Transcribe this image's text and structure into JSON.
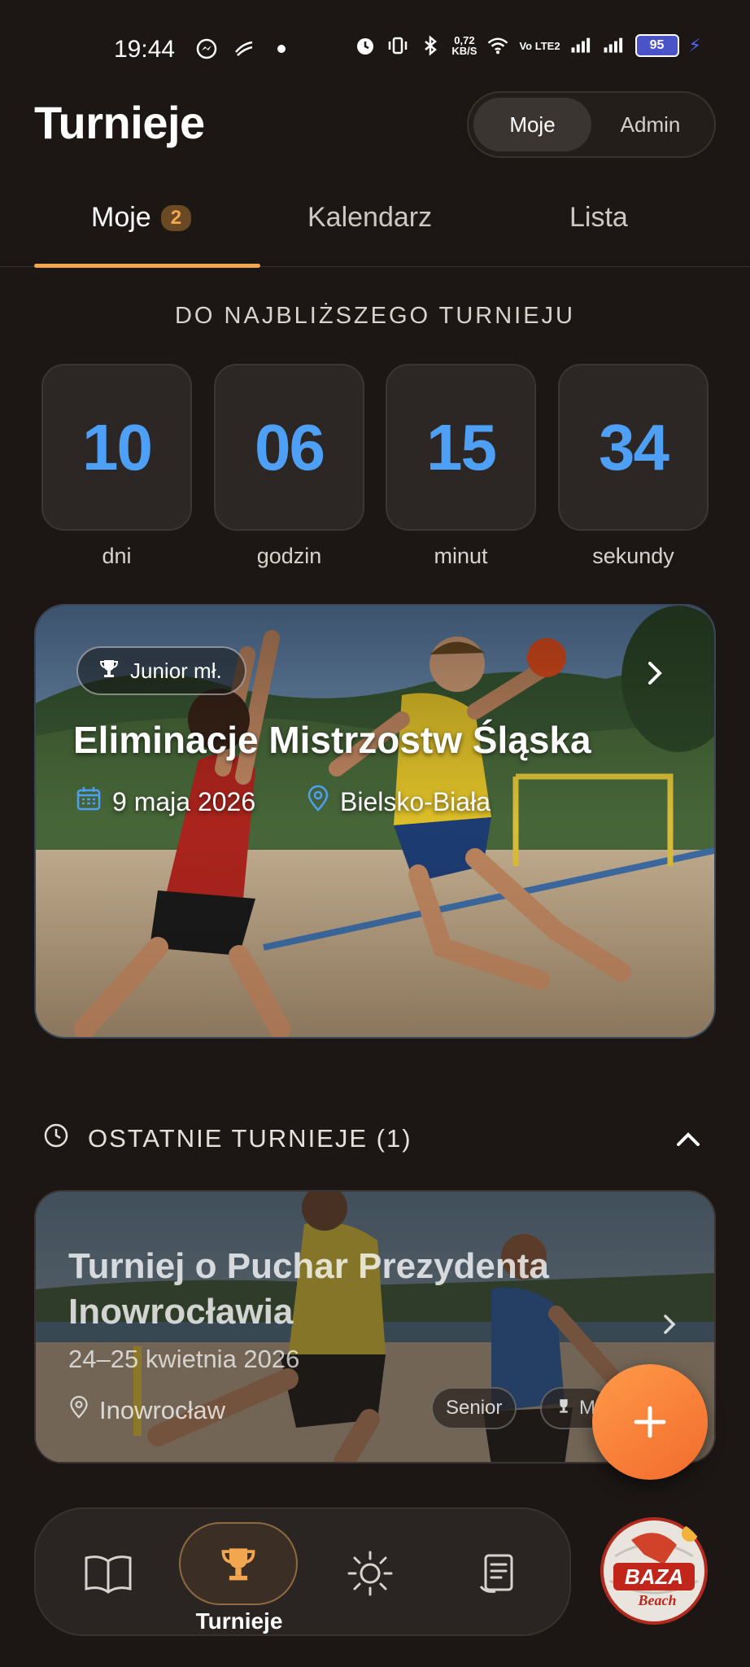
{
  "status_bar": {
    "time": "19:44",
    "net_speed_value": "0,72",
    "net_speed_unit": "KB/S",
    "volte": "Vo LTE2",
    "battery": "95"
  },
  "header": {
    "title": "Turnieje",
    "segment": {
      "left": "Moje",
      "right": "Admin",
      "selected": "Moje"
    }
  },
  "tabs": [
    {
      "label": "Moje",
      "badge": "2",
      "active": true
    },
    {
      "label": "Kalendarz",
      "active": false
    },
    {
      "label": "Lista",
      "active": false
    }
  ],
  "countdown": {
    "heading": "DO NAJBLIŻSZEGO TURNIEJU",
    "units": [
      {
        "value": "10",
        "label": "dni"
      },
      {
        "value": "06",
        "label": "godzin"
      },
      {
        "value": "15",
        "label": "minut"
      },
      {
        "value": "34",
        "label": "sekundy"
      }
    ]
  },
  "upcoming": {
    "category": "Junior mł.",
    "title": "Eliminacje Mistrzostw Śląska",
    "date": "9 maja 2026",
    "location": "Bielsko-Biała"
  },
  "recent": {
    "heading": "OSTATNIE TURNIEJE (1)",
    "items": [
      {
        "title": "Turniej o Puchar Prezydenta Inowrocławia",
        "date": "24–25 kwietnia 2026",
        "location": "Inowrocław",
        "chips": [
          "Senior",
          "M"
        ]
      }
    ]
  },
  "nav": {
    "active_label": "Turnieje",
    "logo_text_1": "BAZA",
    "logo_text_2": "Beach"
  },
  "colors": {
    "accent": "#f1a64f",
    "countdown_number": "#4da0f5",
    "fab": "#f26b2b",
    "background": "#1c1715"
  },
  "icons": {
    "status_left": [
      "messenger-icon",
      "notification-icon",
      "dot-icon"
    ],
    "status_right": [
      "alarm-icon",
      "vibrate-icon",
      "bluetooth-icon",
      "wifi-icon",
      "signal-icon",
      "battery-icon"
    ],
    "nav": [
      "book-icon",
      "trophy-icon",
      "sun-icon",
      "notes-icon"
    ]
  }
}
